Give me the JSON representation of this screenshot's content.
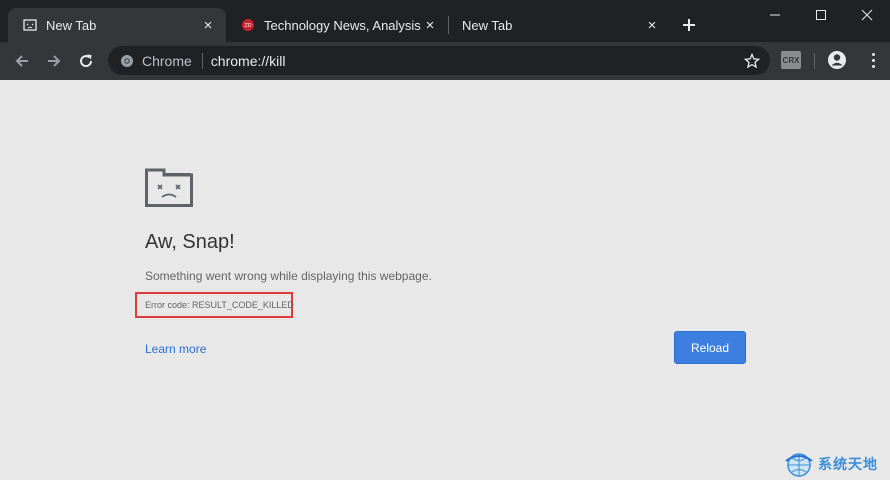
{
  "tabs": [
    {
      "title": "New Tab",
      "favicon": "sad-page-icon",
      "active": true,
      "close": "×"
    },
    {
      "title": "Technology News, Analysis, C",
      "favicon": "site-favicon",
      "active": false,
      "close": "×"
    },
    {
      "title": "New Tab",
      "favicon": "none",
      "active": false,
      "close": "×"
    }
  ],
  "new_tab_label": "+",
  "window_controls": {
    "minimize": "minimize-icon",
    "maximize": "maximize-icon",
    "close": "close-icon"
  },
  "toolbar": {
    "back": "back-arrow-icon",
    "forward": "forward-arrow-icon",
    "reload": "reload-icon",
    "omnibox": {
      "chip_label": "Chrome",
      "url": "chrome://kill"
    },
    "bookmark": "star-icon",
    "extension_label": "CRX",
    "profile": "profile-icon",
    "menu": "kebab-menu-icon"
  },
  "page": {
    "heading": "Aw, Snap!",
    "message": "Something went wrong while displaying this webpage.",
    "error_code": "Error code: RESULT_CODE_KILLED",
    "learn_more": "Learn more",
    "reload_button": "Reload"
  },
  "watermark": {
    "text": "系统天地"
  },
  "colors": {
    "tabstrip": "#202124",
    "toolbar": "#35363a",
    "page_bg": "#e8e8e8",
    "link": "#2a6fd6",
    "reload_button": "#3c7fe0",
    "highlight_box": "#e03b3b"
  }
}
